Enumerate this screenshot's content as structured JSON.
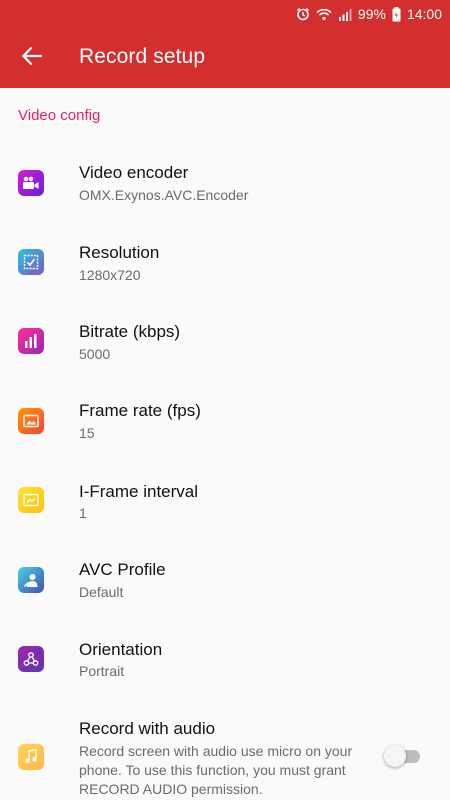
{
  "status_bar": {
    "battery_text": "99%",
    "time": "14:00",
    "icons": [
      "alarm-icon",
      "wifi-icon",
      "signal-icon",
      "battery-icon"
    ]
  },
  "app_bar": {
    "title": "Record setup",
    "back_icon": "arrow-left-icon",
    "color": "#d32f2f"
  },
  "section": {
    "title": "Video config",
    "color": "#e91e63"
  },
  "settings": [
    {
      "label": "Video encoder",
      "value": "OMX.Exynos.AVC.Encoder",
      "icon": "video-camera-icon"
    },
    {
      "label": "Resolution",
      "value": "1280x720",
      "icon": "resolution-icon"
    },
    {
      "label": "Bitrate (kbps)",
      "value": "5000",
      "icon": "bitrate-bars-icon"
    },
    {
      "label": "Frame rate (fps)",
      "value": "15",
      "icon": "frame-rate-icon"
    },
    {
      "label": "I-Frame interval",
      "value": "1",
      "icon": "frame-interval-icon"
    },
    {
      "label": "AVC Profile",
      "value": "Default",
      "icon": "profile-icon"
    },
    {
      "label": "Orientation",
      "value": "Portrait",
      "icon": "orientation-icon"
    }
  ],
  "audio": {
    "label": "Record with audio",
    "description": "Record screen with audio use micro on your phone. To use this function, you must grant RECORD AUDIO permission.",
    "icon": "music-note-icon",
    "enabled": false
  }
}
